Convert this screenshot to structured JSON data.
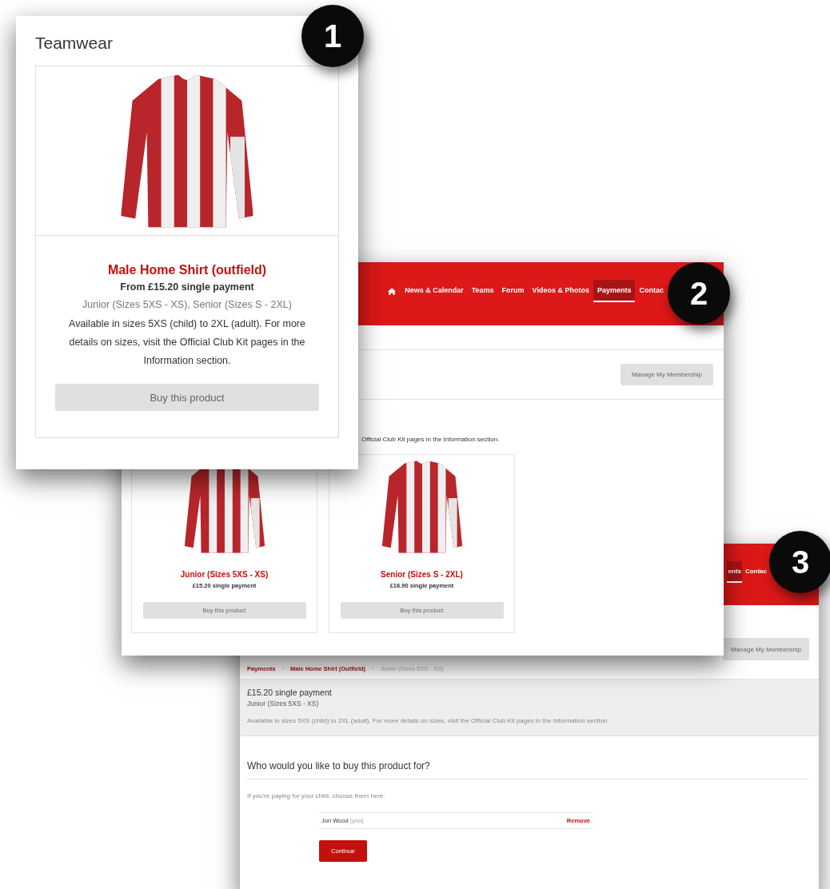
{
  "callouts": [
    {
      "number": "1"
    },
    {
      "number": "2"
    },
    {
      "number": "3"
    }
  ],
  "teamwear_panel": {
    "title": "Teamwear",
    "product": {
      "name": "Male Home Shirt (outfield)",
      "price": "From £15.20 single payment",
      "variants": "Junior (Sizes 5XS - XS), Senior (Sizes S - 2XL)",
      "description": "Available in sizes 5XS (child) to 2XL (adult). For more details on sizes, visit the Official Club Kit pages in the Information section.",
      "button": "Buy this product"
    }
  },
  "payments_page": {
    "nav": [
      {
        "label": "News & Calendar",
        "selected": false
      },
      {
        "label": "Teams",
        "selected": false
      },
      {
        "label": "Forum",
        "selected": false
      },
      {
        "label": "Videos & Photos",
        "selected": false
      },
      {
        "label": "Payments",
        "selected": true
      },
      {
        "label": "Contac",
        "selected": false
      }
    ],
    "membership_button": "Manage My Membership",
    "description": "Official Club Kit pages in the Information section.",
    "products": [
      {
        "name": "Junior (Sizes 5XS - XS)",
        "price": "£15.20 single payment",
        "button": "Buy this product"
      },
      {
        "name": "Senior (Sizes S - 2XL)",
        "price": "£16.90 single payment",
        "button": "Buy this product"
      }
    ]
  },
  "purchase_page": {
    "nav": [
      {
        "label": "ents",
        "selected": true
      },
      {
        "label": "Contac",
        "selected": false
      }
    ],
    "membership_button": "Manage My Membership",
    "breadcrumb_separator": "›",
    "breadcrumb": [
      {
        "label": "Payments",
        "current": false
      },
      {
        "label": "Male Home Shirt (Outfield)",
        "current": false
      },
      {
        "label": "Junior (Sizes 5XS - XS)",
        "current": true
      }
    ],
    "summary": {
      "price": "£15.20 single payment",
      "variant": "Junior (Sizes 5XS - XS)",
      "description": "Available in sizes 5XS (child) to 2XL (adult). For more details on sizes, visit the Official Club Kit pages in the Information section."
    },
    "question": "Who would you like to buy this product for?",
    "hint": "If you're paying for your child, choose them here.",
    "person": {
      "name": "Jon Wood",
      "note": "(you)",
      "action": "Remove"
    },
    "continue_button": "Continue"
  }
}
